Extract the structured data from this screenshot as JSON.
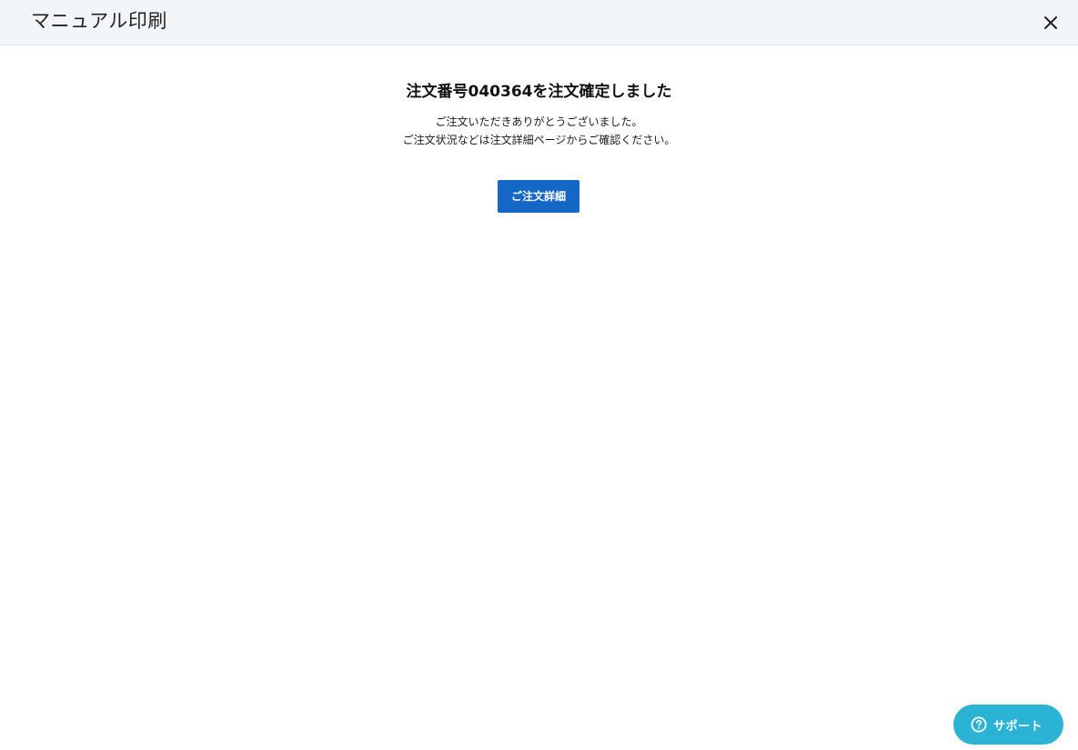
{
  "header": {
    "title": "マニュアル印刷",
    "close_icon": "close-icon"
  },
  "confirmation": {
    "title": "注文番号040364を注文確定しました",
    "message_line1": "ご注文いただきありがとうございました。",
    "message_line2": "ご注文状況などは注文詳細ページからご確認ください。",
    "detail_button_label": "ご注文詳細"
  },
  "support": {
    "label": "サポート",
    "icon": "question-circle-icon"
  },
  "colors": {
    "header_bg": "#f3f6f9",
    "primary": "#1567c6",
    "support": "#2bb3d6"
  }
}
